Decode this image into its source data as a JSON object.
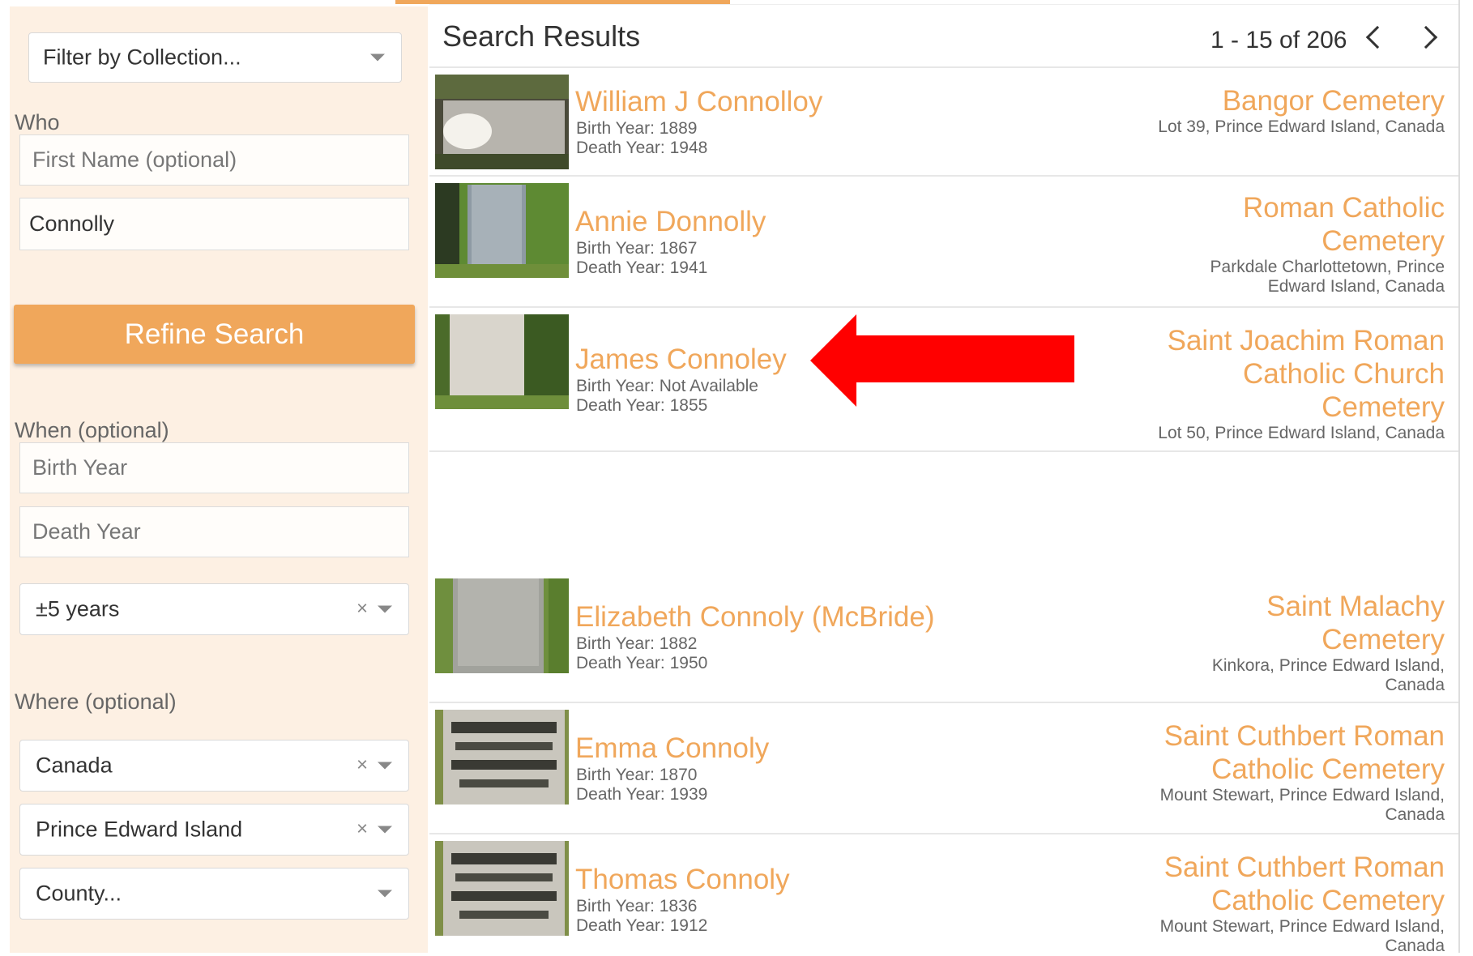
{
  "sidebar": {
    "collection_filter": "Filter by Collection...",
    "who_label": "Who",
    "first_name_placeholder": "First Name (optional)",
    "last_name_value": "Connolly",
    "refine_button": "Refine Search",
    "when_label": "When (optional)",
    "birth_year_placeholder": "Birth Year",
    "death_year_placeholder": "Death Year",
    "range_value": "±5 years",
    "where_label": "Where (optional)",
    "country_value": "Canada",
    "province_value": "Prince Edward Island",
    "county_value": "County...",
    "clear_glyph": "×"
  },
  "results": {
    "title": "Search Results",
    "pagination": "1 - 15 of 206",
    "birth_prefix": "Birth Year:",
    "death_prefix": "Death Year:",
    "items": [
      {
        "name": "William J Connolloy",
        "birth": "1889",
        "death": "1948",
        "cemetery_lines": [
          "Bangor Cemetery"
        ],
        "location_lines": [
          "Lot 39, Prince Edward Island, Canada"
        ]
      },
      {
        "name": "Annie Donnolly",
        "birth": "1867",
        "death": "1941",
        "cemetery_lines": [
          "Roman Catholic",
          "Cemetery"
        ],
        "location_lines": [
          "Parkdale Charlottetown, Prince",
          "Edward Island, Canada"
        ]
      },
      {
        "name": "James Connoley",
        "birth": "Not Available",
        "death": "1855",
        "cemetery_lines": [
          "Saint Joachim Roman",
          "Catholic Church",
          "Cemetery"
        ],
        "location_lines": [
          "Lot 50, Prince Edward Island, Canada"
        ]
      },
      {
        "name": "Elizabeth Connoly (McBride)",
        "birth": "1882",
        "death": "1950",
        "cemetery_lines": [
          "Saint Malachy",
          "Cemetery"
        ],
        "location_lines": [
          "Kinkora, Prince Edward Island,",
          "Canada"
        ]
      },
      {
        "name": "Emma Connoly",
        "birth": "1870",
        "death": "1939",
        "cemetery_lines": [
          "Saint Cuthbert Roman",
          "Catholic Cemetery"
        ],
        "location_lines": [
          "Mount Stewart, Prince Edward Island,",
          "Canada"
        ]
      },
      {
        "name": "Thomas Connoly",
        "birth": "1836",
        "death": "1912",
        "cemetery_lines": [
          "Saint Cuthbert Roman",
          "Catholic Cemetery"
        ],
        "location_lines": [
          "Mount Stewart, Prince Edward Island,",
          "Canada"
        ]
      }
    ]
  },
  "colors": {
    "accent": "#f0a75b",
    "sidebar_bg": "#fdf0e3",
    "arrow": "#ff0000"
  },
  "icons": {
    "prev": "chevron-left-icon",
    "next": "chevron-right-icon",
    "dropdown": "chevron-down-icon",
    "annotation": "red-arrow-icon"
  }
}
